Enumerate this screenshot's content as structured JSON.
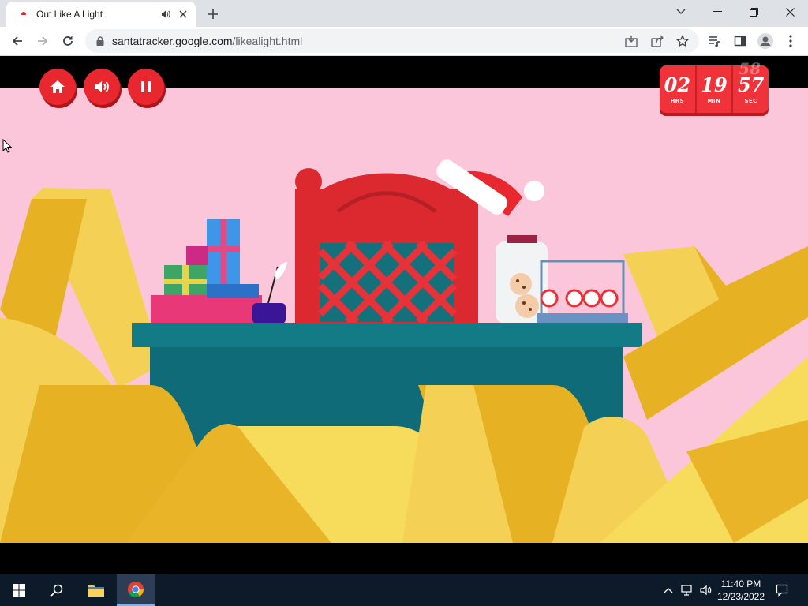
{
  "browser": {
    "tab": {
      "title": "Out Like A Light"
    },
    "url": {
      "host": "santatracker.google.com",
      "path": "/likealight.html"
    }
  },
  "game": {
    "buttons": [
      "home-icon",
      "speaker-icon",
      "pause-icon"
    ],
    "timer": {
      "hours": "02",
      "hours_label": "HRS",
      "minutes": "19",
      "minutes_label": "MIN",
      "seconds": "57",
      "seconds_label": "SEC",
      "next_seconds": "58"
    }
  },
  "taskbar": {
    "time": "11:40 PM",
    "date": "12/23/2022"
  },
  "colors": {
    "accent_red": "#e8282e",
    "background_pink": "#fcc6da",
    "desk_teal": "#137b86",
    "ribbon_yellow": "#f7cf3b"
  }
}
